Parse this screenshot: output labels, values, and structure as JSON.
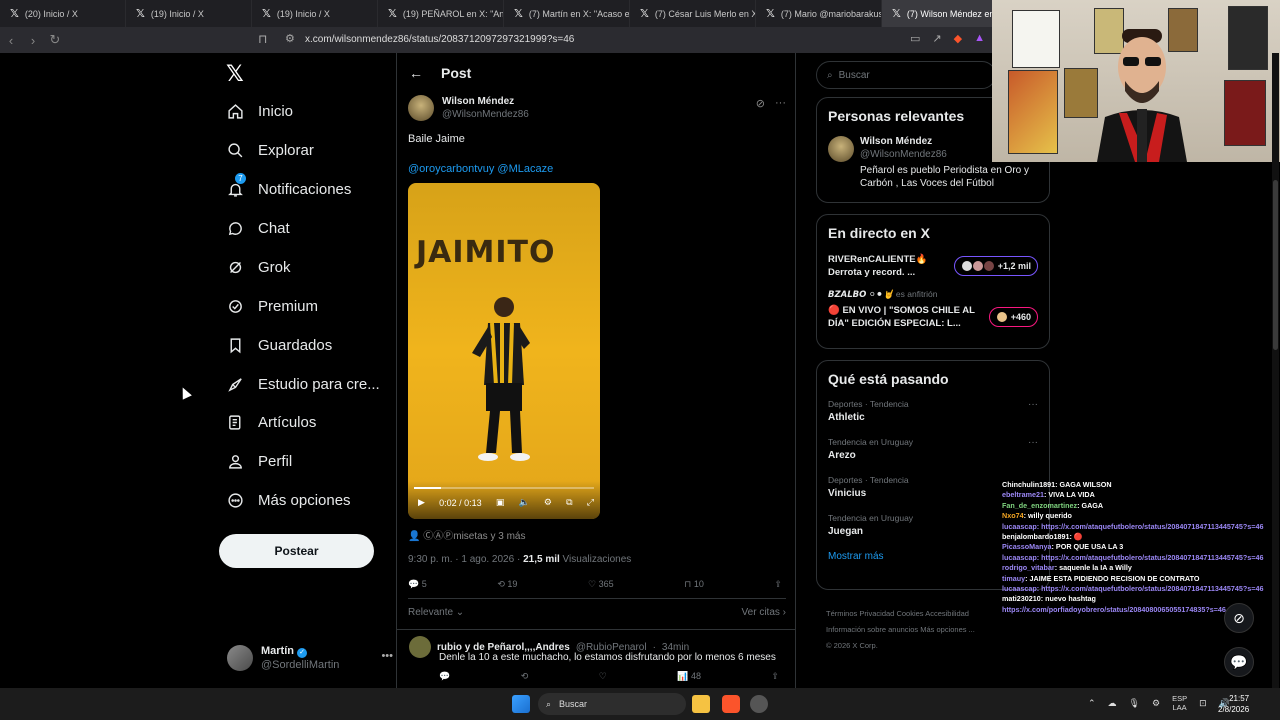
{
  "tabs": [
    {
      "label": "(20) Inicio / X"
    },
    {
      "label": "(19) Inicio / X"
    },
    {
      "label": "(19) Inicio / X"
    },
    {
      "label": "(19) PEÑAROL en X: \"Anot"
    },
    {
      "label": "(7) Martín en X: \"Acaso el"
    },
    {
      "label": "(7) César Luis Merlo en X"
    },
    {
      "label": "(7) Mario @mariobarakus"
    },
    {
      "label": "(7) Wilson Méndez en"
    }
  ],
  "browser": {
    "url": "x.com/wilsonmendez86/status/2083712097297321999?s=46"
  },
  "sidebar": {
    "items": [
      {
        "label": "Inicio",
        "icon": "home-icon"
      },
      {
        "label": "Explorar",
        "icon": "search-icon"
      },
      {
        "label": "Notificaciones",
        "icon": "bell-icon",
        "badge": "7"
      },
      {
        "label": "Chat",
        "icon": "chat-icon"
      },
      {
        "label": "Grok",
        "icon": "grok-icon"
      },
      {
        "label": "Premium",
        "icon": "premium-icon"
      },
      {
        "label": "Guardados",
        "icon": "bookmark-icon"
      },
      {
        "label": "Estudio para cre...",
        "icon": "rocket-icon"
      },
      {
        "label": "Artículos",
        "icon": "article-icon"
      },
      {
        "label": "Perfil",
        "icon": "profile-icon"
      },
      {
        "label": "Más opciones",
        "icon": "more-icon"
      }
    ],
    "post_button": "Postear",
    "account": {
      "name": "Martín",
      "handle": "@SordelliMartin"
    }
  },
  "main": {
    "header": "Post",
    "post": {
      "author_name": "Wilson Méndez",
      "author_handle": "@WilsonMendez86",
      "text": "Baile Jaime",
      "mentions": "@oroycarbontvuy @MLacaze",
      "media_title": "JAIMITO",
      "video_time": "0:02 / 0:13",
      "video_progress": 0.15,
      "tagged": "ⒸⒶⓅmisetas y 3 más",
      "timestamp": "9:30 p. m. · 1 ago. 2026 · ",
      "views_count": "21,5 mil",
      "views_label": " Visualizaciones",
      "replies": "5",
      "reposts": "19",
      "likes": "365",
      "bookmarks": "10",
      "sort_label": "Relevante",
      "quotes_label": "Ver citas"
    },
    "reply": {
      "author_name": "rubio y de Peñarol,,,,Andres",
      "author_handle": "@RubioPenarol",
      "time": "34min",
      "text": "Denle la 10 a este muchacho, lo estamos disfrutando por lo menos 6 meses",
      "views": "48"
    }
  },
  "right": {
    "search_placeholder": "Buscar",
    "relevant": {
      "title": "Personas relevantes",
      "name": "Wilson Méndez",
      "handle": "@WilsonMendez86",
      "bio": "Peñarol es pueblo Periodista en Oro y Carbón , Las Voces del Fútbol"
    },
    "live": {
      "title": "En directo en X",
      "items": [
        {
          "text": "RIVERenCALIENTE🔥 Derrota y record. ...",
          "count": "+1,2 mil"
        },
        {
          "host": "𝘽𝙕𝘼𝙇𝘽𝙊 ⚪⚫🤘",
          "host_suffix": "es anfitrión",
          "text": "🔴 EN VIVO | \"SOMOS CHILE AL DÍA\" EDICIÓN ESPECIAL: L...",
          "count": "+460"
        }
      ]
    },
    "trends": {
      "title": "Qué está pasando",
      "items": [
        {
          "category": "Deportes · Tendencia",
          "topic": "Athletic"
        },
        {
          "category": "Tendencia en Uruguay",
          "topic": "Arezo"
        },
        {
          "category": "Deportes · Tendencia",
          "topic": "Vinicius"
        },
        {
          "category": "Tendencia en Uruguay",
          "topic": "Juegan"
        }
      ],
      "show_more": "Mostrar más"
    },
    "footer": {
      "line1": "Términos    Privacidad    Cookies    Accesibilidad",
      "line2": "Información sobre anuncios    Más opciones ...",
      "line3": "© 2026 X Corp."
    }
  },
  "chat": [
    {
      "user": "Chinchulin1891",
      "msg": ": GAGA WILSON",
      "color": "#ffffff"
    },
    {
      "user": "ebeltrame21",
      "msg": ": VIVA LA VIDA",
      "color": "#9b87f5"
    },
    {
      "user": "Fan_de_enzomartinez",
      "msg": ": GAGA",
      "color": "#7fd37f"
    },
    {
      "user": "Nxo74",
      "msg": ": willy querido",
      "color": "#f5a623"
    },
    {
      "user": "lucaascap",
      "msg": ": https://x.com/ataquefutbolero/status/2084071847113445745?s=46",
      "color": "#9b87f5"
    },
    {
      "user": "benjalombardo1891",
      "msg": ": 🔴",
      "color": "#ffffff"
    },
    {
      "user": "PicassoManya",
      "msg": ": POR QUE USA LA 3",
      "color": "#9b87f5"
    },
    {
      "user": "lucaascap",
      "msg": ": https://x.com/ataquefutbolero/status/2084071847113445745?s=46",
      "color": "#9b87f5"
    },
    {
      "user": "rodrigo_vitabar",
      "msg": ": saquenle la IA a Willy",
      "color": "#9b87f5"
    },
    {
      "user": "timauy",
      "msg": ": JAIME ESTA PIDIENDO RECISION DE CONTRATO",
      "color": "#9b87f5"
    },
    {
      "user": "lucaascap",
      "msg": ": https://x.com/ataquefutbolero/status/2084071847113445745?s=46",
      "color": "#9b87f5"
    },
    {
      "user": "mati230210",
      "msg": ": nuevo hashtag",
      "color": "#ffffff"
    },
    {
      "user": "",
      "msg": "https://x.com/porfiadoyobrero/status/2084080065055174835?s=46",
      "color": "#9b87f5"
    }
  ],
  "taskbar": {
    "search": "Buscar",
    "lang_top": "ESP",
    "lang_bottom": "LAA",
    "time": "21:57",
    "date": "2/8/2026"
  }
}
